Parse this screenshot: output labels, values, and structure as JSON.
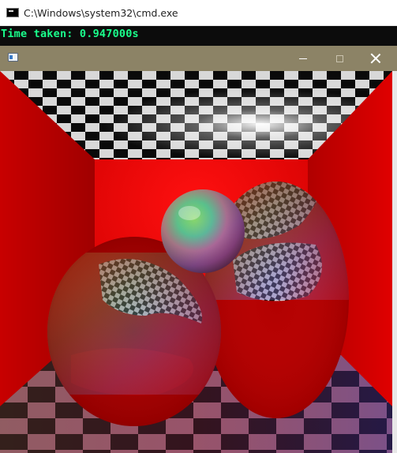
{
  "cmd_window": {
    "title": "C:\\Windows\\system32\\cmd.exe",
    "icon": "console-icon",
    "output_line": "Time taken: 0.947000s",
    "text_color": "#1aff8c"
  },
  "render_window": {
    "titlebar_color": "#8c8366",
    "icon": "window-app-icon",
    "controls": {
      "minimize": "minimize-icon",
      "maximize": "maximize-icon",
      "close": "close-icon"
    }
  },
  "scene": {
    "description_colors": {
      "walls": "#c00000",
      "checker_light": "#ffffff",
      "checker_dark": "#000000"
    }
  }
}
